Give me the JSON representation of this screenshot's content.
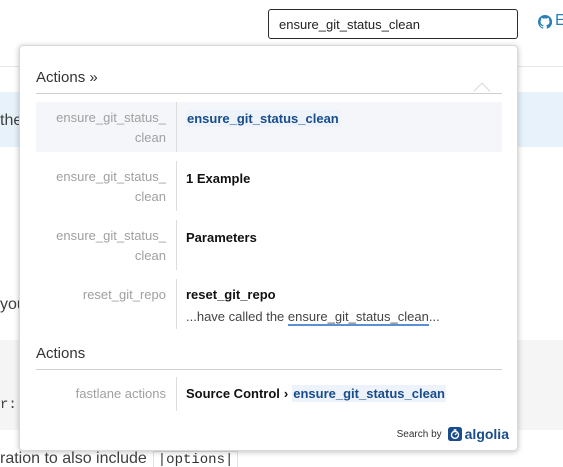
{
  "header": {
    "search_value": "ensure_git_status_clean",
    "github_label": "E"
  },
  "background": {
    "text_1": "the",
    "text_2": "you",
    "text_3": "r:",
    "text_bottom": "ration to also include",
    "code_bottom": "|options|"
  },
  "dropdown": {
    "section1_title": "Actions »",
    "section2_title": "Actions",
    "rows": [
      {
        "category": "ensure_git_status_\nclean",
        "title": "ensure_git_status_clean"
      },
      {
        "category": "ensure_git_status_\nclean",
        "title": "1 Example"
      },
      {
        "category": "ensure_git_status_\nclean",
        "title": "Parameters"
      },
      {
        "category": "reset_git_repo",
        "title": "reset_git_repo",
        "snippet_pre": "...have called the ",
        "snippet_hl": "ensure_git_status_clean",
        "snippet_post": "..."
      }
    ],
    "row5": {
      "category": "fastlane actions",
      "title_pre": "Source Control",
      "arrow": "›",
      "title_hl": "ensure_git_status_clean"
    },
    "footer": {
      "search_by": "Search by",
      "brand": "algolia"
    }
  },
  "colors": {
    "highlight": "#174d8c",
    "link_underline": "#5b8fd6",
    "info_band": "#e7f2fa"
  }
}
